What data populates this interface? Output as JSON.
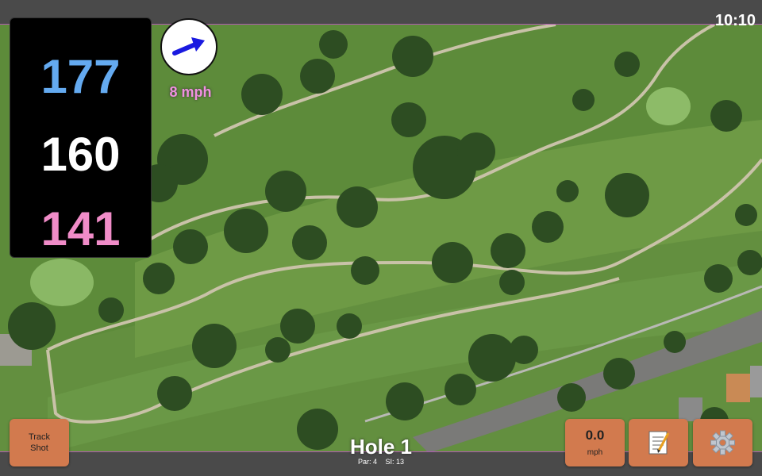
{
  "status": {
    "time": "10:10"
  },
  "yardages": {
    "back": "177",
    "middle": "160",
    "front": "141"
  },
  "wind": {
    "speed": "8 mph",
    "icon": "wind-arrow-icon"
  },
  "buttons": {
    "track_shot_line1": "Track",
    "track_shot_line2": "Shot",
    "speed_value": "0.0",
    "speed_unit": "mph",
    "notes_icon": "notepad-icon",
    "settings_icon": "gear-icon"
  },
  "hole": {
    "title": "Hole 1",
    "par": "Par: 4",
    "si": "SI: 13"
  },
  "colors": {
    "back_yardage": "#64aaf0",
    "middle_yardage": "#ffffff",
    "front_yardage": "#f08cc8",
    "button": "#d27a4e",
    "wind_text": "#f090e0"
  }
}
